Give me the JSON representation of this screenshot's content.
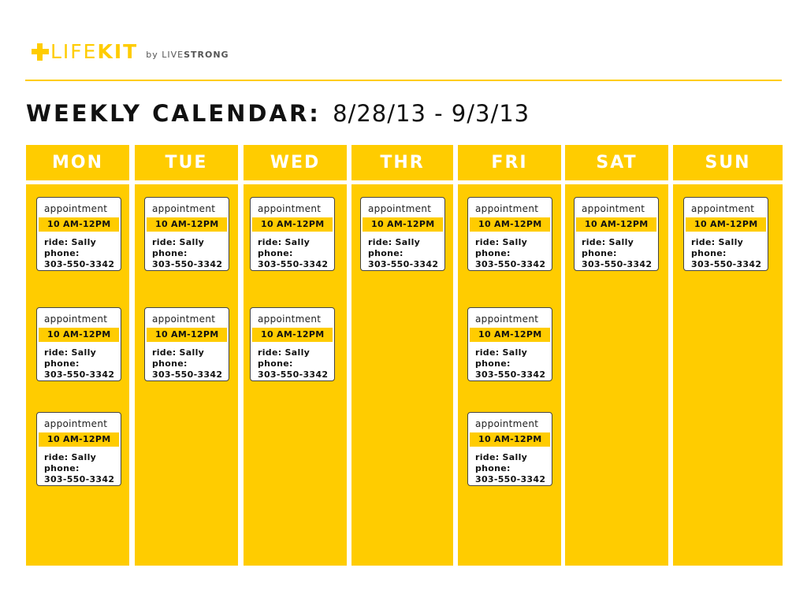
{
  "brand": {
    "life": "LIFE",
    "kit": "KIT",
    "by": "by",
    "live": "LIVE",
    "strong": "STRONG"
  },
  "title": {
    "label": "WEEKLY CALENDAR:",
    "dates": "8/28/13 - 9/3/13"
  },
  "appointment_template": {
    "label": "appointment",
    "time": "10 AM-12PM",
    "ride": "ride: Sally",
    "phone_label": "phone:",
    "phone": "303-550-3342"
  },
  "days": [
    {
      "name": "MON",
      "appointment_count": 3
    },
    {
      "name": "TUE",
      "appointment_count": 2
    },
    {
      "name": "WED",
      "appointment_count": 2
    },
    {
      "name": "THR",
      "appointment_count": 1
    },
    {
      "name": "FRI",
      "appointment_count": 3
    },
    {
      "name": "SAT",
      "appointment_count": 1
    },
    {
      "name": "SUN",
      "appointment_count": 1
    }
  ],
  "colors": {
    "accent": "#FFCC00",
    "text": "#111111",
    "card_border": "#444444"
  }
}
